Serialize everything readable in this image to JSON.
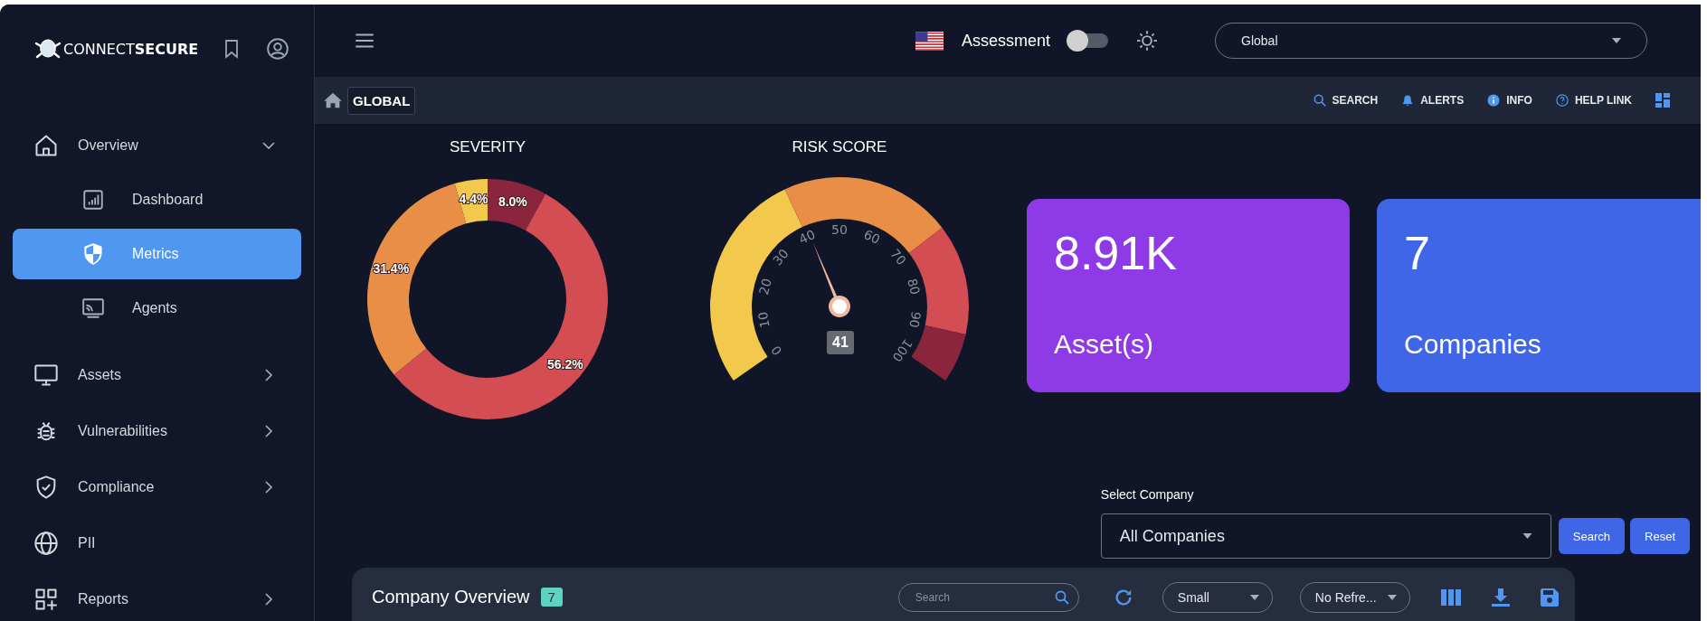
{
  "sidebar": {
    "logo": "CONNECT**SECURE**",
    "items": [
      {
        "label": "Overview",
        "kind": "home",
        "expanded": true,
        "selected": false,
        "children": [
          {
            "label": "Dashboard",
            "kind": "chart",
            "selected": false
          },
          {
            "label": "Metrics",
            "kind": "shield",
            "selected": true
          },
          {
            "label": "Agents",
            "kind": "cast",
            "selected": false
          }
        ]
      },
      {
        "label": "Assets",
        "kind": "monitor",
        "expanded": false,
        "selected": false
      },
      {
        "label": "Vulnerabilities",
        "kind": "bug",
        "expanded": false,
        "selected": false
      },
      {
        "label": "Compliance",
        "kind": "check-shield",
        "expanded": false,
        "selected": false
      },
      {
        "label": "PII",
        "kind": "globe",
        "selected": false
      },
      {
        "label": "Reports",
        "kind": "grid-plus",
        "expanded": false,
        "selected": false
      }
    ]
  },
  "topbar": {
    "mode_label": "Assessment",
    "mode_toggle": {
      "on": false
    },
    "scope_select": {
      "value": "Global"
    }
  },
  "breadcrumb": {
    "label": "GLOBAL",
    "actions": [
      {
        "label": "SEARCH",
        "kind": "search"
      },
      {
        "label": "ALERTS",
        "kind": "bell"
      },
      {
        "label": "INFO",
        "kind": "info"
      },
      {
        "label": "HELP LINK",
        "kind": "help"
      }
    ]
  },
  "severity": {
    "chart_data": {
      "type": "donut",
      "title": "SEVERITY",
      "values": [
        8.0,
        56.2,
        31.4,
        4.4
      ],
      "colors": [
        "#8b253e",
        "#d34d52",
        "#e88e46",
        "#f2c94c"
      ],
      "value_labels": [
        "8.0%",
        "56.2%",
        "31.4%",
        "4.4%"
      ]
    }
  },
  "risk_score": {
    "title": "RISK SCORE",
    "level": 0.41,
    "reading": "41",
    "ticks": [
      "0",
      "10",
      "20",
      "30",
      "40",
      "50",
      "60",
      "70",
      "80",
      "90",
      "100"
    ]
  },
  "stat_cards": [
    {
      "value": "8.91K",
      "label": "Asset(s)",
      "color": "#8e3ae6"
    },
    {
      "value": "7",
      "label": "Companies",
      "color": "#4066e8"
    }
  ],
  "company_filter": {
    "label": "Select Company",
    "value": "All Companies",
    "buttons": [
      "Search",
      "Reset"
    ]
  },
  "company_overview": {
    "title": "Company Overview",
    "count": "7",
    "search": {
      "placeholder": "Search"
    },
    "size_select": "Small",
    "refresh_select": "No Refre..."
  }
}
